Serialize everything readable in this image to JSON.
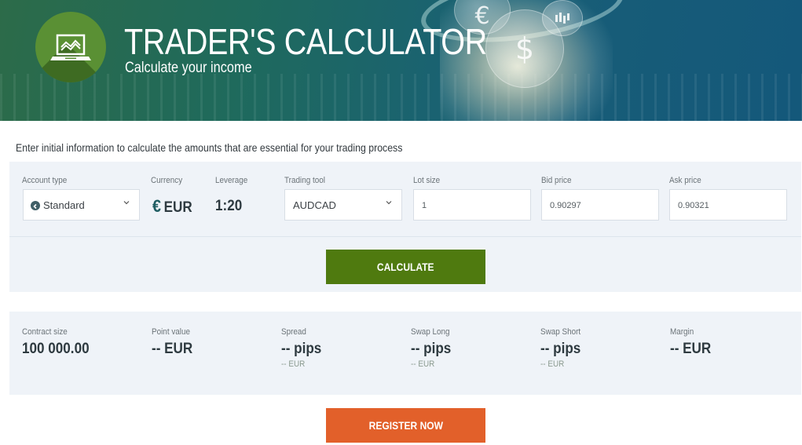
{
  "header": {
    "title": "TRADER'S CALCULATOR",
    "subtitle": "Calculate your income",
    "logo_icon": "laptop-chart-icon",
    "decorations": [
      "€",
      "$",
      "candlestick-chart-icon"
    ]
  },
  "intro_text": "Enter initial information to calculate the amounts that are essential for your trading process",
  "inputs": {
    "account_type": {
      "label": "Account type",
      "value": "Standard",
      "icon": "account-badge-icon"
    },
    "currency": {
      "label": "Currency",
      "symbol": "€",
      "value": "EUR"
    },
    "leverage": {
      "label": "Leverage",
      "value": "1:20"
    },
    "trading_tool": {
      "label": "Trading tool",
      "value": "AUDCAD"
    },
    "lot_size": {
      "label": "Lot size",
      "value": "1"
    },
    "bid_price": {
      "label": "Bid price",
      "value": "0.90297"
    },
    "ask_price": {
      "label": "Ask price",
      "value": "0.90321"
    }
  },
  "calculate_button": "CALCULATE",
  "results": [
    {
      "label": "Contract size",
      "value": "100 000.00",
      "sub": ""
    },
    {
      "label": "Point value",
      "value": "-- EUR",
      "sub": ""
    },
    {
      "label": "Spread",
      "value": "-- pips",
      "sub": "-- EUR"
    },
    {
      "label": "Swap Long",
      "value": "-- pips",
      "sub": "-- EUR"
    },
    {
      "label": "Swap Short",
      "value": "-- pips",
      "sub": "-- EUR"
    },
    {
      "label": "Margin",
      "value": "-- EUR",
      "sub": ""
    }
  ],
  "register_button": "REGISTER NOW",
  "colors": {
    "calculate": "#4f7a0f",
    "register": "#e2602a",
    "panel_bg": "#eff3f8",
    "logo_green": "#5a9034"
  }
}
